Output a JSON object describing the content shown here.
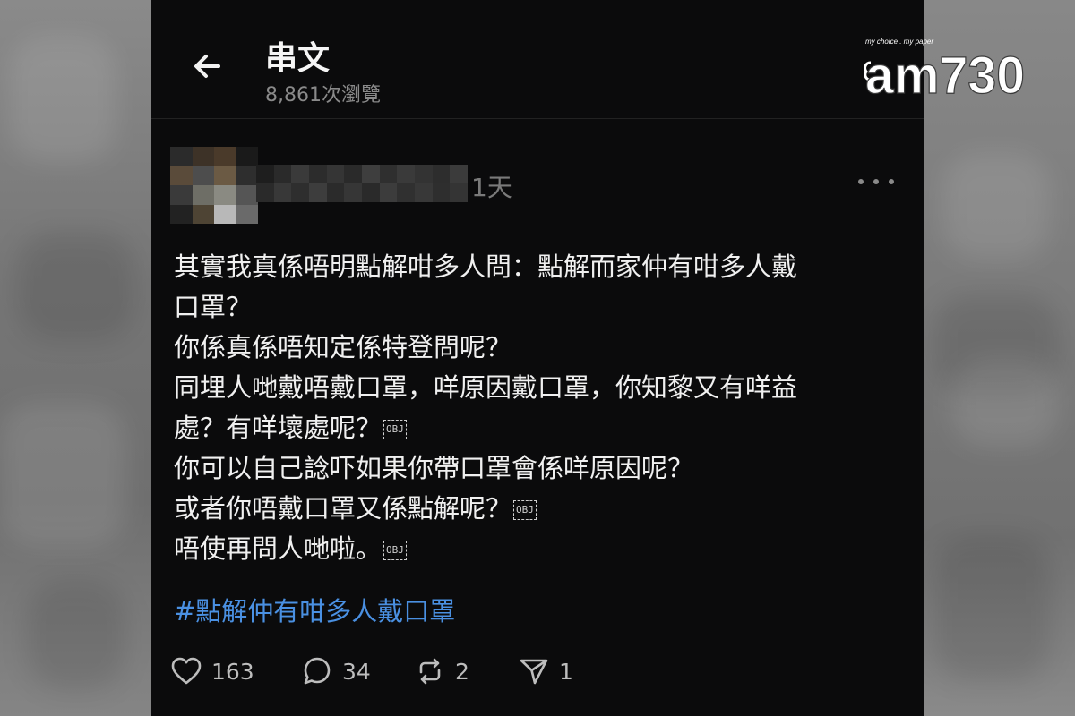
{
  "header": {
    "title": "串文",
    "views": "8,861次瀏覽"
  },
  "post": {
    "timestamp": "1天",
    "lines": [
      "其實我真係唔明點解咁多人問：點解而家仲有咁多人戴",
      "口罩？",
      "你係真係唔知定係特登問呢？",
      "同埋人哋戴唔戴口罩，咩原因戴口罩，你知黎又有咩益",
      "處？有咩壞處呢？",
      "你可以自己諗吓如果你帶口罩會係咩原因呢？",
      "或者你唔戴口罩又係點解呢？",
      "唔使再問人哋啦。"
    ],
    "obj_marker": "OBJ",
    "hashtag": "#點解仲有咁多人戴口罩"
  },
  "actions": {
    "likes": "163",
    "comments": "34",
    "reposts": "2",
    "shares": "1"
  },
  "icons": [
    "back-arrow-icon",
    "more-dots-icon",
    "heart-icon",
    "comment-icon",
    "repost-icon",
    "send-icon"
  ],
  "watermark": {
    "tagline": "my choice . my paper",
    "brand": "am730"
  },
  "colors": {
    "screen_bg": "#0b0b0c",
    "text": "#f0f0f0",
    "muted": "#8a8a8a",
    "hashtag": "#4a90e2"
  }
}
